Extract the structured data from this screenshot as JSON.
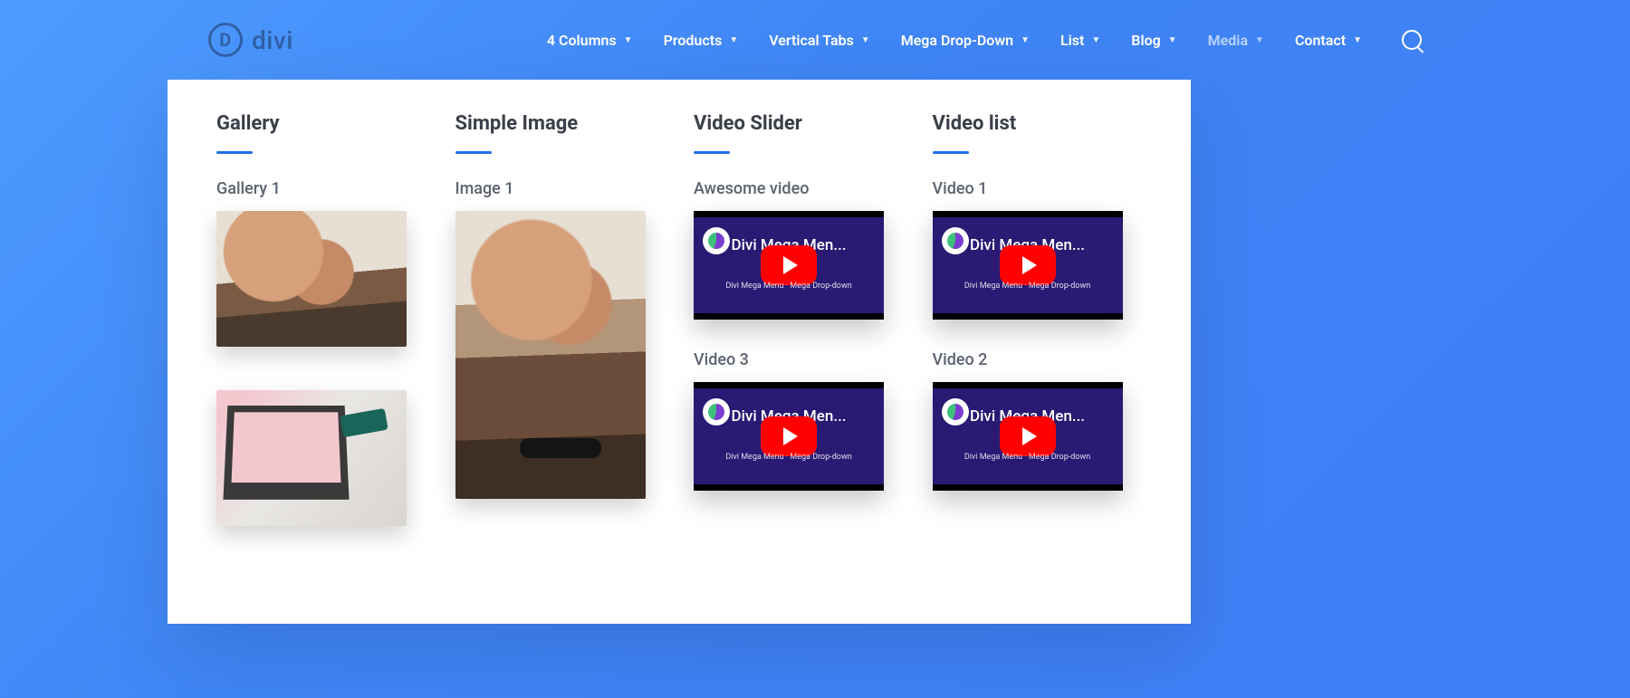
{
  "brand": {
    "name": "divi",
    "letter": "D"
  },
  "nav": [
    {
      "label": "4 Columns",
      "active": false
    },
    {
      "label": "Products",
      "active": false
    },
    {
      "label": "Vertical Tabs",
      "active": false
    },
    {
      "label": "Mega Drop-Down",
      "active": false
    },
    {
      "label": "List",
      "active": false
    },
    {
      "label": "Blog",
      "active": false
    },
    {
      "label": "Media",
      "active": true
    },
    {
      "label": "Contact",
      "active": false
    }
  ],
  "columns": {
    "gallery": {
      "title": "Gallery",
      "item_title": "Gallery 1"
    },
    "simple_image": {
      "title": "Simple Image",
      "item_title": "Image 1"
    },
    "video_slider": {
      "title": "Video Slider",
      "items": [
        {
          "label": "Awesome video",
          "video_title": "Divi Mega Men...",
          "sub": "Divi Mega Menu · Mega Drop-down"
        },
        {
          "label": "Video 3",
          "video_title": "Divi Mega Men...",
          "sub": "Divi Mega Menu · Mega Drop-down"
        }
      ]
    },
    "video_list": {
      "title": "Video list",
      "items": [
        {
          "label": "Video 1",
          "video_title": "Divi Mega Men...",
          "sub": "Divi Mega Menu · Mega Drop-down"
        },
        {
          "label": "Video 2",
          "video_title": "Divi Mega Men...",
          "sub": "Divi Mega Menu · Mega Drop-down"
        }
      ]
    }
  },
  "colors": {
    "accent": "#1f6fe8"
  }
}
